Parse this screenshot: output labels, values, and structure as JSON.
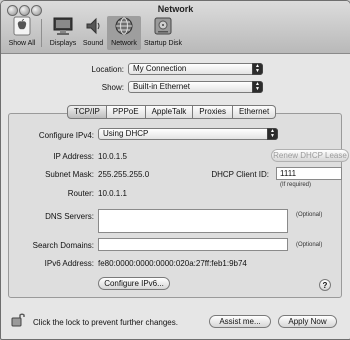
{
  "window": {
    "title": "Network"
  },
  "toolbar": {
    "items": [
      {
        "label": "Show All",
        "icon": "apple-grid-icon"
      },
      {
        "label": "Displays",
        "icon": "display-icon"
      },
      {
        "label": "Sound",
        "icon": "speaker-icon"
      },
      {
        "label": "Network",
        "icon": "globe-icon",
        "selected": true
      },
      {
        "label": "Startup Disk",
        "icon": "disk-icon"
      }
    ]
  },
  "location": {
    "label": "Location:",
    "value": "My Connection"
  },
  "show": {
    "label": "Show:",
    "value": "Built-in Ethernet"
  },
  "tabs": [
    {
      "label": "TCP/IP",
      "active": true
    },
    {
      "label": "PPPoE"
    },
    {
      "label": "AppleTalk"
    },
    {
      "label": "Proxies"
    },
    {
      "label": "Ethernet"
    }
  ],
  "tcpip": {
    "configure_label": "Configure IPv4:",
    "configure_value": "Using DHCP",
    "ip_label": "IP Address:",
    "ip_value": "10.0.1.5",
    "renew_button": "Renew DHCP Lease",
    "subnet_label": "Subnet Mask:",
    "subnet_value": "255.255.255.0",
    "dhcp_client_label": "DHCP Client ID:",
    "dhcp_client_value": "1111",
    "if_required": "(If required)",
    "router_label": "Router:",
    "router_value": "10.0.1.1",
    "dns_label": "DNS Servers:",
    "dns_value": "",
    "optional_label": "(Optional)",
    "search_label": "Search Domains:",
    "search_value": "",
    "ipv6_label": "IPv6 Address:",
    "ipv6_value": "fe80:0000:0000:0000:020a:27ff:feb1:9b74",
    "configure_ipv6_button": "Configure IPv6...",
    "help": "?"
  },
  "footer": {
    "lock_text": "Click the lock to prevent further changes.",
    "assist_button": "Assist me...",
    "apply_button": "Apply Now"
  }
}
